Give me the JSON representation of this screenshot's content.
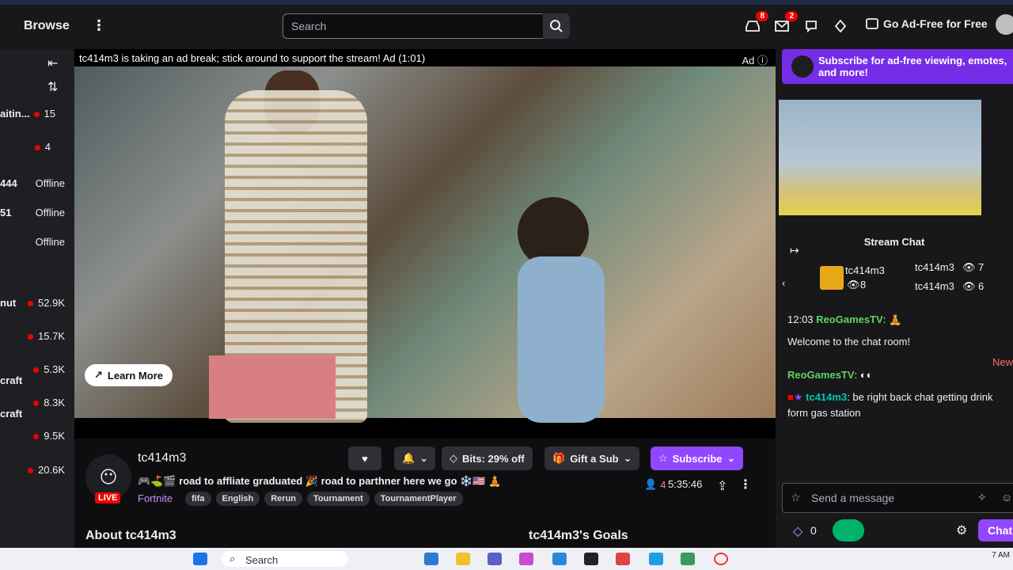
{
  "topnav": {
    "browse": "Browse",
    "search_placeholder": "Search",
    "inbox_badge": "8",
    "whispers_badge": "2",
    "adfree": "Go Ad-Free for Free"
  },
  "sidebar": {
    "items": [
      {
        "name": "aitin...",
        "value": "15"
      },
      {
        "name": "",
        "value": "4"
      },
      {
        "name": "444",
        "value": "Offline"
      },
      {
        "name": "51",
        "value": "Offline"
      },
      {
        "name": "",
        "value": "Offline"
      },
      {
        "name": "nut",
        "value": "52.9K"
      },
      {
        "name": "",
        "value": "15.7K"
      },
      {
        "name": "craft",
        "value": "5.3K"
      },
      {
        "name": "craft",
        "value": "8.3K"
      },
      {
        "name": "",
        "value": "9.5K"
      },
      {
        "name": "",
        "value": "20.6K"
      }
    ]
  },
  "player": {
    "ad_text": "tc414m3 is taking an ad break; stick around to support the stream! Ad (1:01)",
    "ad_label": "Ad",
    "learn_more": "Learn More"
  },
  "channel": {
    "name": "tc414m3",
    "live": "LIVE",
    "title": "🎮⛳🎬 road to affliate graduated 🎉 road to parthner here we go ❄️🇺🇸 🧘",
    "category": "Fortnite",
    "tags": [
      "fifa",
      "English",
      "Rerun",
      "Tournament",
      "TournamentPlayer"
    ],
    "bits": "Bits: 29% off",
    "gift": "Gift a Sub",
    "subscribe": "Subscribe",
    "viewers": "4",
    "uptime": "5:35:46",
    "about": "About tc414m3",
    "goals": "tc414m3's Goals"
  },
  "chat": {
    "sub_banner": "Subscribe for ad-free viewing, emotes, and more!",
    "title": "Stream Chat",
    "gifters": [
      {
        "name": "tc414m3",
        "count": "8"
      },
      {
        "name": "tc414m3",
        "count": "7"
      },
      {
        "name": "tc414m3",
        "count": "6"
      }
    ],
    "messages": [
      {
        "time": "12:03",
        "user": "ReoGamesTV",
        "text": ""
      },
      {
        "time": "",
        "user": "",
        "text": "Welcome to the chat room!"
      },
      {
        "time": "",
        "user": "ReoGamesTV",
        "text": ""
      },
      {
        "time": "",
        "user": "tc414m3",
        "text": "be right back chat getting drink form gas station"
      }
    ],
    "new_label": "New",
    "input_placeholder": "Send a message",
    "bits_count": "0",
    "chat_button": "Chat"
  },
  "taskbar": {
    "search": "Search",
    "time": "7 AM"
  }
}
